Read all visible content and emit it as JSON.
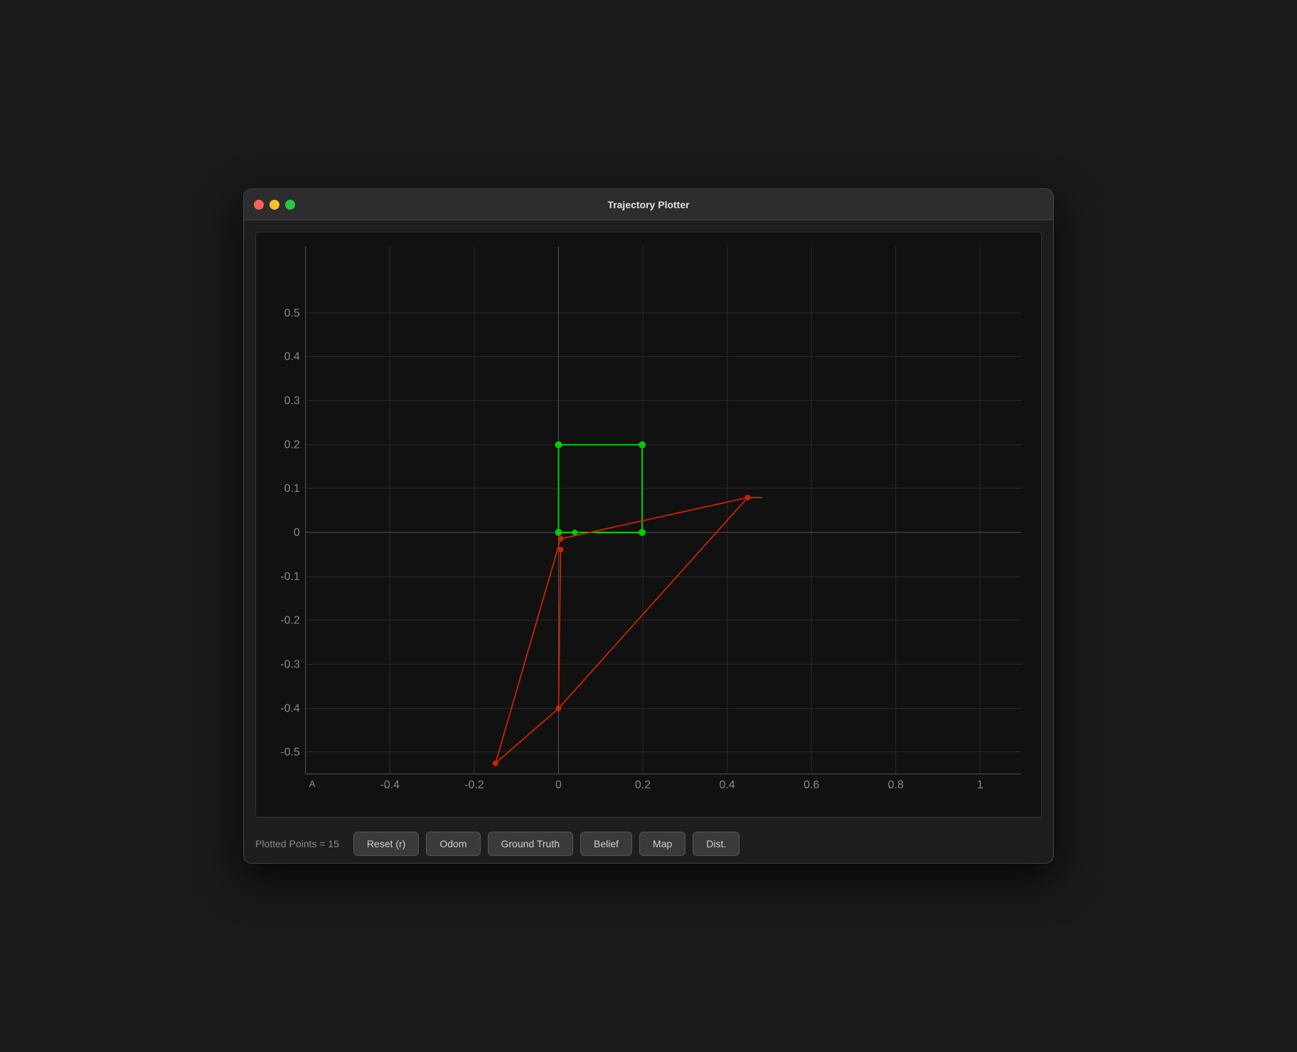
{
  "window": {
    "title": "Trajectory Plotter"
  },
  "traffic_lights": {
    "red": "close",
    "yellow": "minimize",
    "green": "maximize"
  },
  "bottom_bar": {
    "plotted_points_label": "Plotted Points = 15",
    "buttons": [
      {
        "id": "reset",
        "label": "Reset (r)"
      },
      {
        "id": "odom",
        "label": "Odom"
      },
      {
        "id": "ground-truth",
        "label": "Ground Truth"
      },
      {
        "id": "belief",
        "label": "Belief"
      },
      {
        "id": "map",
        "label": "Map"
      },
      {
        "id": "dist",
        "label": "Dist."
      }
    ]
  },
  "plot": {
    "x_axis": {
      "labels": [
        "-0.4",
        "-0.2",
        "0",
        "0.2",
        "0.4",
        "0.6",
        "0.8",
        "1"
      ]
    },
    "y_axis": {
      "labels": [
        "0.5",
        "0.4",
        "0.3",
        "0.2",
        "0.1",
        "0",
        "-0.1",
        "-0.2",
        "-0.3",
        "-0.4",
        "-0.5"
      ]
    }
  }
}
